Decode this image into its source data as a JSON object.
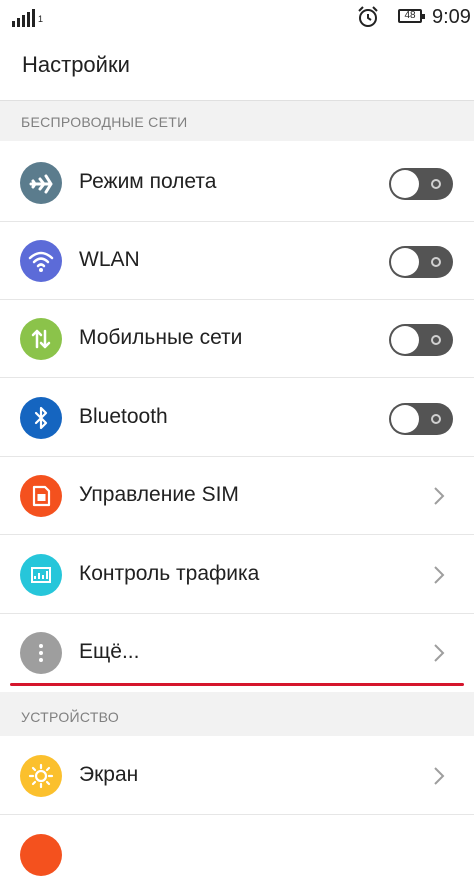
{
  "status_bar": {
    "sim_number": "1",
    "battery_level": "48",
    "time": "9:09",
    "icons": [
      "signal-icon",
      "alarm-icon",
      "battery-icon"
    ]
  },
  "header": {
    "title": "Настройки"
  },
  "sections": [
    {
      "title": "БЕСПРОВОДНЫЕ СЕТИ",
      "items": [
        {
          "label": "Режим полета",
          "icon": "airplane-icon",
          "icon_color": "#5b7c8d",
          "control": "toggle",
          "on": false
        },
        {
          "label": "WLAN",
          "icon": "wifi-icon",
          "icon_color": "#5c6bd8",
          "control": "toggle",
          "on": false
        },
        {
          "label": "Мобильные сети",
          "icon": "mobile-data-icon",
          "icon_color": "#8bc34a",
          "control": "toggle",
          "on": false
        },
        {
          "label": "Bluetooth",
          "icon": "bluetooth-icon",
          "icon_color": "#1565c0",
          "control": "toggle",
          "on": false
        },
        {
          "label": "Управление SIM",
          "icon": "sim-card-icon",
          "icon_color": "#f4511e",
          "control": "chevron"
        },
        {
          "label": "Контроль трафика",
          "icon": "traffic-chart-icon",
          "icon_color": "#26c6da",
          "control": "chevron"
        },
        {
          "label": "Ещё...",
          "icon": "more-icon",
          "icon_color": "#9e9e9e",
          "control": "chevron"
        }
      ]
    },
    {
      "title": "УСТРОЙСТВО",
      "items": [
        {
          "label": "Экран",
          "icon": "brightness-icon",
          "icon_color": "#fbc02d",
          "control": "chevron"
        }
      ]
    }
  ],
  "colors": {
    "highlight_underline": "#d5152c",
    "toggle_off": "#545454"
  }
}
